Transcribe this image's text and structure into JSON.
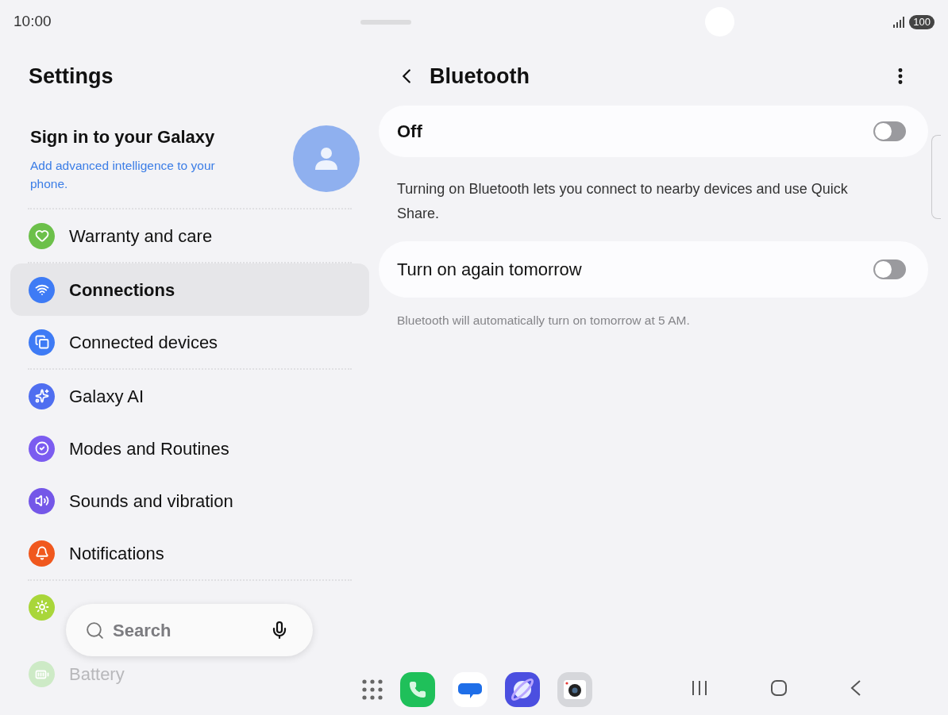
{
  "status_bar": {
    "time": "10:00",
    "battery": "100"
  },
  "sidebar": {
    "title": "Settings",
    "account": {
      "title": "Sign in to your Galaxy",
      "subtitle": "Add advanced intelligence to your phone."
    },
    "groups": [
      {
        "items": [
          {
            "label": "Warranty and care",
            "color": "#6cc04a",
            "selected": false,
            "faded": false
          }
        ]
      },
      {
        "items": [
          {
            "label": "Connections",
            "color": "#3e7bf5",
            "selected": true,
            "faded": false
          },
          {
            "label": "Connected devices",
            "color": "#3e7bf5",
            "selected": false,
            "faded": false
          }
        ]
      },
      {
        "items": [
          {
            "label": "Galaxy AI",
            "color": "#4f6ef0",
            "selected": false,
            "faded": false
          },
          {
            "label": "Modes and Routines",
            "color": "#7b5cf0",
            "selected": false,
            "faded": false
          },
          {
            "label": "Sounds and vibration",
            "color": "#7457e8",
            "selected": false,
            "faded": false
          },
          {
            "label": "Notifications",
            "color": "#f0581e",
            "selected": false,
            "faded": false
          }
        ]
      },
      {
        "items": [
          {
            "color": "#a9d63a",
            "selected": false,
            "faded": false
          },
          {
            "label": "Battery",
            "color": "#cdeac6",
            "selected": false,
            "faded": true
          }
        ]
      }
    ]
  },
  "search": {
    "placeholder": "Search"
  },
  "detail": {
    "title": "Bluetooth",
    "main_switch": {
      "label": "Off",
      "on": false
    },
    "description": "Turning on Bluetooth lets you connect to nearby devices and use Quick Share.",
    "options": [
      {
        "label": "Turn on again tomorrow",
        "on": false,
        "note": "Bluetooth will automatically turn on tomorrow at 5 AM."
      }
    ]
  }
}
